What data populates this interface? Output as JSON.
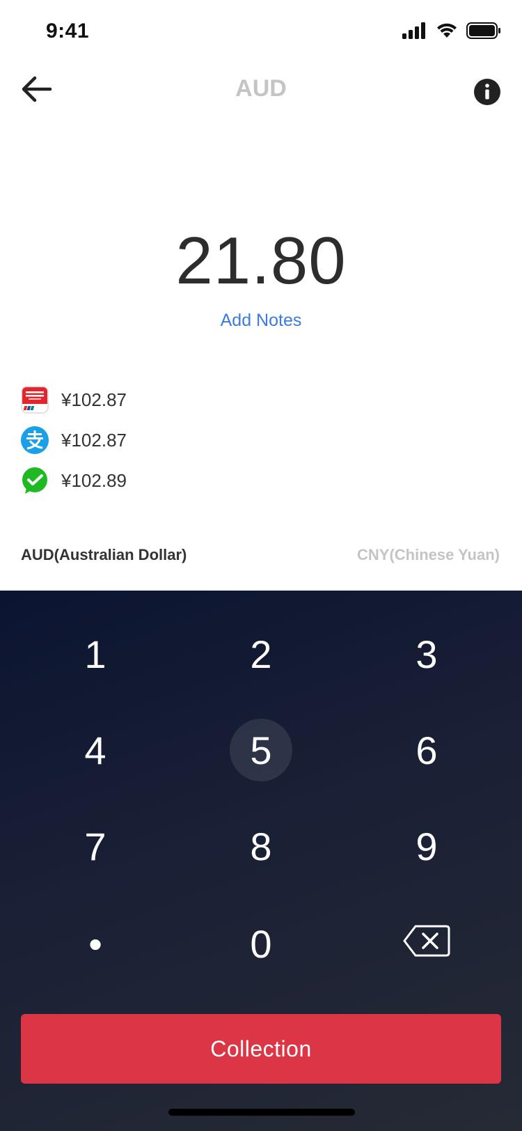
{
  "status_bar": {
    "time": "9:41"
  },
  "nav": {
    "title": "AUD",
    "back_icon": "arrow-left-icon",
    "info_icon": "info-icon"
  },
  "amount": {
    "value": "21.80",
    "add_notes_label": "Add Notes"
  },
  "payments": [
    {
      "method_icon": "unionpay-icon",
      "value": "¥102.87"
    },
    {
      "method_icon": "alipay-icon",
      "value": "¥102.87"
    },
    {
      "method_icon": "wechat-pay-icon",
      "value": "¥102.89"
    }
  ],
  "currency": {
    "from_label": "AUD(Australian Dollar)",
    "to_label": "CNY(Chinese Yuan)"
  },
  "keypad": {
    "keys": [
      "1",
      "2",
      "3",
      "4",
      "5",
      "6",
      "7",
      "8",
      "9",
      "•",
      "0",
      "backspace-icon"
    ],
    "highlighted_key": "5"
  },
  "actions": {
    "collection_label": "Collection"
  },
  "colors": {
    "accent_blue": "#3a7be0",
    "action_red": "#dc3545",
    "keypad_dark": "#1a2035",
    "muted_gray": "#c4c4c4"
  }
}
